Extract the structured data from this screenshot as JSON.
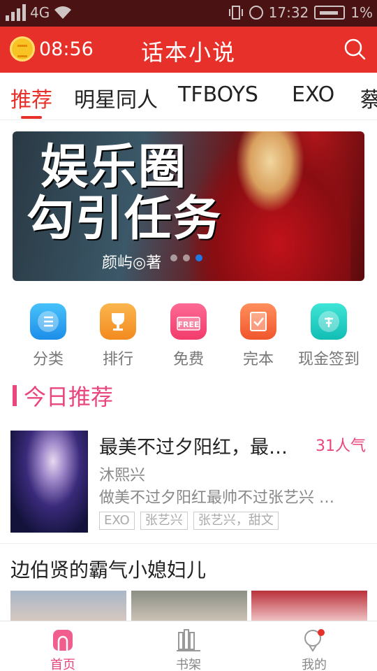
{
  "status_bar": {
    "network": "4G",
    "time": "17:32",
    "battery": "1%"
  },
  "header": {
    "timer": "08:56",
    "title": "话本小说"
  },
  "tabs": [
    {
      "label": "推荐"
    },
    {
      "label": "明星同人"
    },
    {
      "label": "TFBOYS"
    },
    {
      "label": "EXO"
    },
    {
      "label": "蔡"
    }
  ],
  "banner": {
    "title_line1": "娱乐圈",
    "title_line2": "勾引任务",
    "author": "颜屿◎著",
    "active_dot": 2
  },
  "quick": [
    {
      "label": "分类",
      "icon": "list-icon",
      "color": "#2aa6f2"
    },
    {
      "label": "排行",
      "icon": "trophy-icon",
      "color": "#f6a43a"
    },
    {
      "label": "免费",
      "icon": "free-icon",
      "color": "#f5467a"
    },
    {
      "label": "完本",
      "icon": "check-note-icon",
      "color": "#fb7a4a"
    },
    {
      "label": "现金签到",
      "icon": "sign-in-icon",
      "color": "#20d3c6"
    }
  ],
  "section1": {
    "title": "今日推荐"
  },
  "book": {
    "title": "最美不过夕阳红，最…",
    "popularity": "31人气",
    "author": "沐熙兴",
    "desc": "做美不过夕阳红最帅不过张艺兴 …",
    "tags": [
      "EXO",
      "张艺兴",
      "张艺兴，甜文"
    ]
  },
  "section2": {
    "title": "边伯贤的霸气小媳妇儿"
  },
  "bottom_nav": [
    {
      "label": "首页",
      "icon": "home-icon"
    },
    {
      "label": "书架",
      "icon": "bookshelf-icon"
    },
    {
      "label": "我的",
      "icon": "profile-icon"
    }
  ],
  "colors": {
    "header": "#e8302a",
    "accent_pink": "#e9467c",
    "statusbar": "#4a1212"
  }
}
